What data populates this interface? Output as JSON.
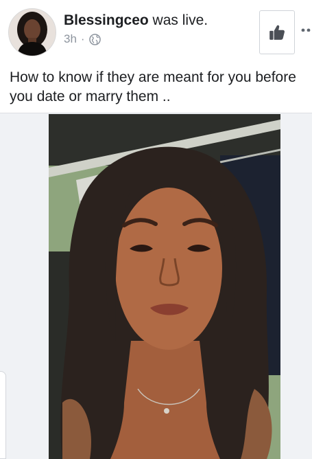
{
  "post": {
    "author_name": "Blessingceo",
    "action_text": " was live.",
    "timestamp": "3h",
    "separator": "·",
    "audience_icon": "globe-icon",
    "caption": "How to know if they are meant for you before you date or marry them .."
  },
  "actions": {
    "like_icon": "thumbs-up-icon",
    "more_icon": "more-options-icon"
  },
  "colors": {
    "text_primary": "#1c1e21",
    "text_secondary": "#8d949e",
    "border": "#cfd3d8",
    "like_icon": "#4b4f56"
  },
  "media": {
    "type": "live-video-recording",
    "icon": "video-frame"
  }
}
